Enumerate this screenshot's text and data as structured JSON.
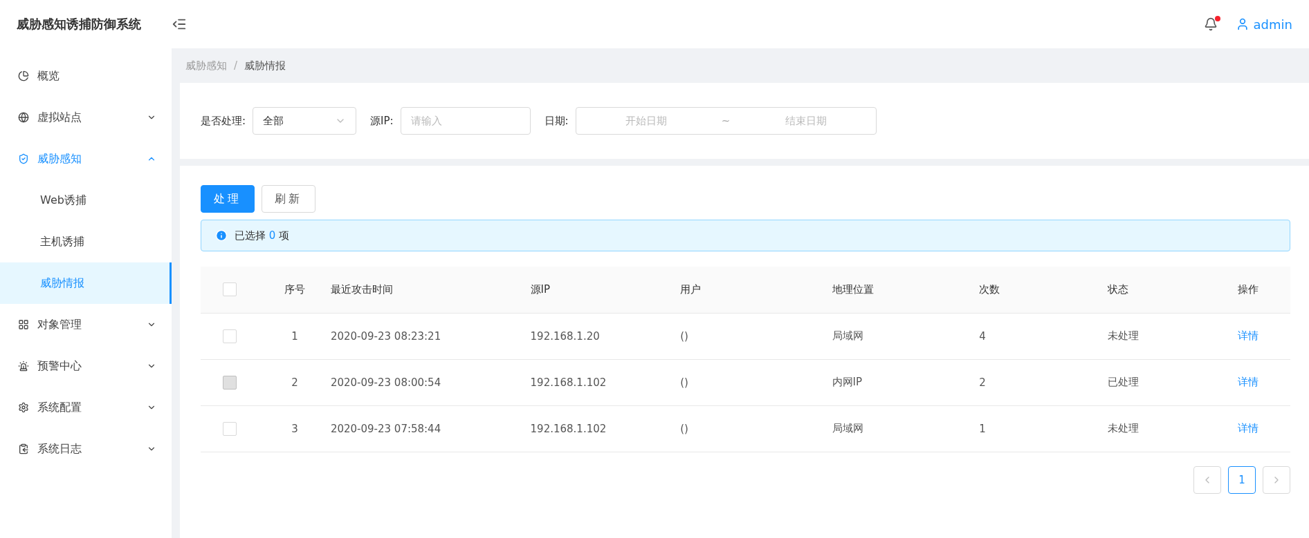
{
  "app_title": "威胁感知诱捕防御系统",
  "header": {
    "notification_dot": true,
    "user": "admin"
  },
  "sidebar": {
    "items": [
      {
        "kind": "link",
        "label": "概览",
        "selected": false
      },
      {
        "kind": "submenu",
        "label": "虚拟站点",
        "expanded": false,
        "selected": false
      },
      {
        "kind": "submenu",
        "label": "威胁感知",
        "expanded": true,
        "selected": true,
        "children": [
          {
            "label": "Web诱捕",
            "selected": false
          },
          {
            "label": "主机诱捕",
            "selected": false
          },
          {
            "label": "威胁情报",
            "selected": true
          }
        ]
      },
      {
        "kind": "submenu",
        "label": "对象管理",
        "expanded": false,
        "selected": false
      },
      {
        "kind": "submenu",
        "label": "预警中心",
        "expanded": false,
        "selected": false
      },
      {
        "kind": "submenu",
        "label": "系统配置",
        "expanded": false,
        "selected": false
      },
      {
        "kind": "submenu",
        "label": "系统日志",
        "expanded": false,
        "selected": false
      }
    ]
  },
  "breadcrumb": {
    "separator": "/",
    "items": [
      "威胁感知",
      "威胁情报"
    ]
  },
  "filters": {
    "processed": {
      "label": "是否处理:",
      "value": "全部"
    },
    "source_ip": {
      "label": "源IP:",
      "placeholder": "请输入"
    },
    "date": {
      "label": "日期:",
      "start_placeholder": "开始日期",
      "separator": "~",
      "end_placeholder": "结束日期"
    }
  },
  "buttons": [
    {
      "label": "处理",
      "kind": "primary"
    },
    {
      "label": "刷新",
      "kind": "default"
    }
  ],
  "selection_alert": {
    "before": "已选择",
    "count": "0",
    "after": "项"
  },
  "table": {
    "columns": [
      "序号",
      "最近攻击时间",
      "源IP",
      "用户",
      "地理位置",
      "次数",
      "状态",
      "操作"
    ],
    "header_checked": false,
    "rows": [
      {
        "checked": false,
        "disabled": false,
        "cells": [
          "1",
          "2020-09-23 08:23:21",
          "192.168.1.20",
          "()",
          "局域网",
          "4",
          "未处理"
        ],
        "action": "详情"
      },
      {
        "checked": false,
        "disabled": true,
        "cells": [
          "2",
          "2020-09-23 08:00:54",
          "192.168.1.102",
          "()",
          "内网IP",
          "2",
          "已处理"
        ],
        "action": "详情"
      },
      {
        "checked": false,
        "disabled": false,
        "cells": [
          "3",
          "2020-09-23 07:58:44",
          "192.168.1.102",
          "()",
          "局域网",
          "1",
          "未处理"
        ],
        "action": "详情"
      }
    ]
  },
  "pagination": {
    "pages": [
      {
        "label": "1",
        "selected": true
      }
    ]
  }
}
